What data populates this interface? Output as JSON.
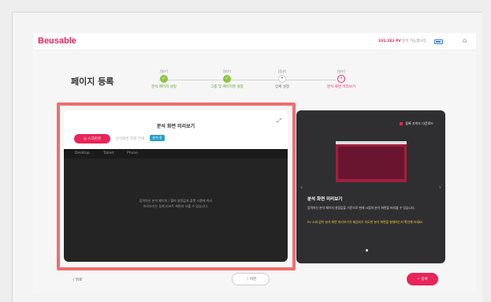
{
  "header": {
    "logo": "Beusable",
    "pv_count": "331,143 PV",
    "pv_text": "분석 가능합니다.",
    "user_icon": "user-icon"
  },
  "page": {
    "title": "페이지 등록"
  },
  "steps": [
    {
      "tag": "[필수]",
      "label": "분석 페이지 설정",
      "state": "done",
      "mark": "✓"
    },
    {
      "tag": "[필수]",
      "label": "그룹 및 페이지명 설정",
      "state": "done",
      "mark": "✓"
    },
    {
      "tag": "[옵션]",
      "label": "상세 설정",
      "state": "todo",
      "mark": "•"
    },
    {
      "tag": "[필수]",
      "label": "분석 화면 미리보기",
      "state": "current",
      "mark": "•"
    }
  ],
  "preview": {
    "title": "분석 화면 미리보기",
    "screenshot_button": "◎ 스크린샷",
    "secondary_tab": "분석화면 조회 안내",
    "badge": "분석 중",
    "device_tabs": [
      "Desktop",
      "Tablet",
      "Phone"
    ],
    "message_line1": "입력하신 분석 페이지 / 헬퍼 설정값과 플랫 시행에 따라",
    "message_line2": "미리보기는 실제 리포트 화면과 다를 수 있습니다."
  },
  "guide": {
    "download": "등록 가이드 다운로드",
    "heading": "분석 화면 미리보기",
    "paragraph": "입력하신 분석 페이지 설정값을 기준으로 현재 시점의 분석 화면을 미리볼 수 있습니다.",
    "highlight": "PV 소비 없이 분석 화면 미리보기가 제공되기 의도한 분석 화면을 발췌하는지 확인해 보세요!"
  },
  "footer": {
    "back": "〈 뒤로",
    "prev": "〈  이전",
    "submit": "✓  등록"
  },
  "colors": {
    "brand": "#e8245a",
    "success": "#8cc63f",
    "highlight_border": "#ef6e6e"
  }
}
